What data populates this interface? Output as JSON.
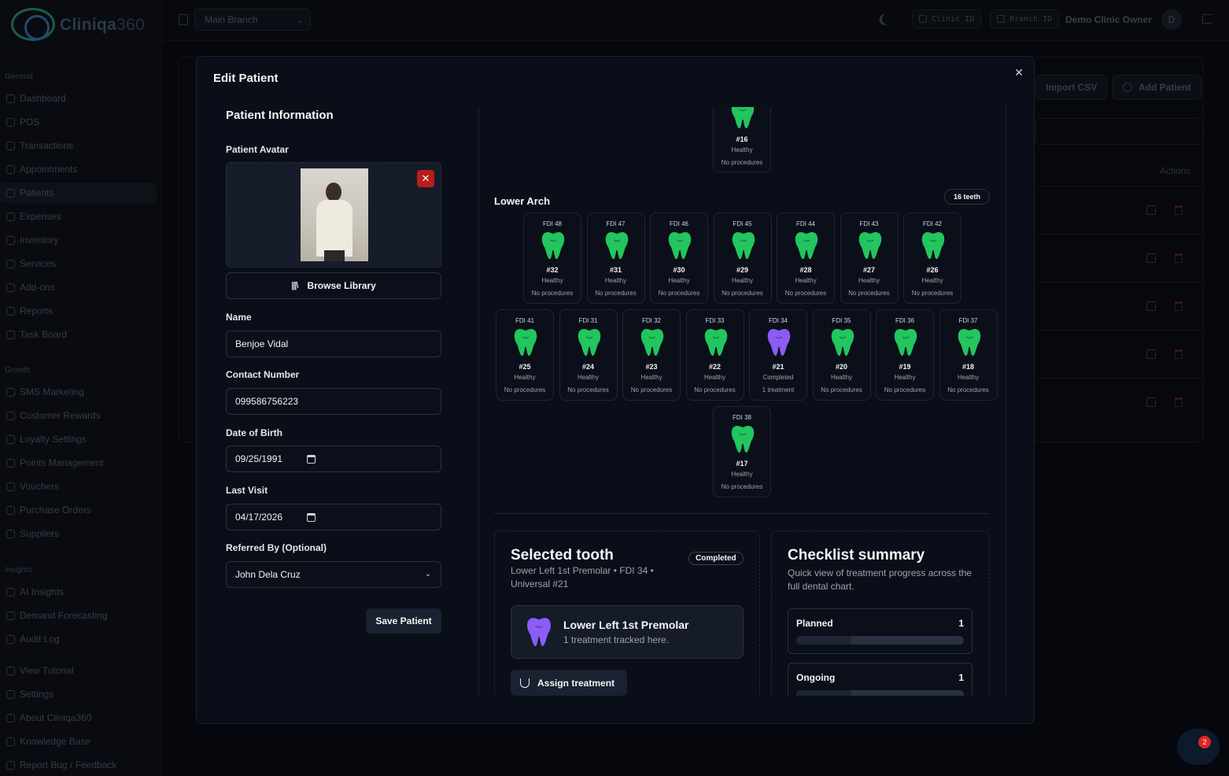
{
  "app": {
    "name": "Cliniqa",
    "name_suffix": "360"
  },
  "sidebar": {
    "sections": [
      {
        "title": "General",
        "items": [
          "Dashboard",
          "POS",
          "Transactions",
          "Appointments",
          "Patients",
          "Expenses",
          "Inventory",
          "Services",
          "Add-ons",
          "Reports",
          "Task Board"
        ]
      },
      {
        "title": "Growth",
        "items": [
          "SMS Marketing",
          "Customer Rewards",
          "Loyalty Settings",
          "Points Management",
          "Vouchers",
          "Purchase Orders",
          "Suppliers"
        ]
      },
      {
        "title": "Insights",
        "items": [
          "AI Insights",
          "Demand Forecasting",
          "Audit Log"
        ]
      }
    ],
    "footer_items": [
      "View Tutorial",
      "Settings",
      "About Cliniqa360",
      "Knowledge Base",
      "Report Bug / Feedback"
    ],
    "active_item": "Patients"
  },
  "topbar": {
    "branch": "Main Branch",
    "clinic_id_label": "Clinic ID",
    "branch_id_label": "Branch ID",
    "owner": "Demo Clinic Owner",
    "avatar_initial": "D"
  },
  "background": {
    "import_label": "Import CSV",
    "add_label": "Add Patient",
    "actions_header": "Actions"
  },
  "notifications": {
    "count": "2"
  },
  "modal": {
    "title": "Edit Patient",
    "form": {
      "section_title": "Patient Information",
      "avatar_label": "Patient Avatar",
      "browse_label": "Browse Library",
      "name_label": "Name",
      "name_value": "Benjoe Vidal",
      "contact_label": "Contact Number",
      "contact_value": "099586756223",
      "dob_label": "Date of Birth",
      "dob_value": "09/25/1991",
      "last_visit_label": "Last Visit",
      "last_visit_value": "04/17/2026",
      "referred_label": "Referred By (Optional)",
      "referred_value": "John Dela Cruz",
      "save_label": "Save Patient"
    },
    "chart": {
      "upper_partial": {
        "fdi": "",
        "number": "#16",
        "status": "Healthy",
        "procedures": "No procedures"
      },
      "lower_title": "Lower Arch",
      "lower_count": "16 teeth",
      "lower_row1": [
        {
          "fdi": "FDI 48",
          "number": "#32",
          "status": "Healthy",
          "procedures": "No procedures",
          "color": "#22c55e"
        },
        {
          "fdi": "FDI 47",
          "number": "#31",
          "status": "Healthy",
          "procedures": "No procedures",
          "color": "#22c55e"
        },
        {
          "fdi": "FDI 46",
          "number": "#30",
          "status": "Healthy",
          "procedures": "No procedures",
          "color": "#22c55e"
        },
        {
          "fdi": "FDI 45",
          "number": "#29",
          "status": "Healthy",
          "procedures": "No procedures",
          "color": "#22c55e"
        },
        {
          "fdi": "FDI 44",
          "number": "#28",
          "status": "Healthy",
          "procedures": "No procedures",
          "color": "#22c55e"
        },
        {
          "fdi": "FDI 43",
          "number": "#27",
          "status": "Healthy",
          "procedures": "No procedures",
          "color": "#22c55e"
        },
        {
          "fdi": "FDI 42",
          "number": "#26",
          "status": "Healthy",
          "procedures": "No procedures",
          "color": "#22c55e"
        }
      ],
      "lower_row2": [
        {
          "fdi": "FDI 41",
          "number": "#25",
          "status": "Healthy",
          "procedures": "No procedures",
          "color": "#22c55e"
        },
        {
          "fdi": "FDI 31",
          "number": "#24",
          "status": "Healthy",
          "procedures": "No procedures",
          "color": "#22c55e"
        },
        {
          "fdi": "FDI 32",
          "number": "#23",
          "status": "Healthy",
          "procedures": "No procedures",
          "color": "#22c55e"
        },
        {
          "fdi": "FDI 33",
          "number": "#22",
          "status": "Healthy",
          "procedures": "No procedures",
          "color": "#22c55e"
        },
        {
          "fdi": "FDI 34",
          "number": "#21",
          "status": "Completed",
          "procedures": "1 treatment",
          "color": "#8b5cf6"
        },
        {
          "fdi": "FDI 35",
          "number": "#20",
          "status": "Healthy",
          "procedures": "No procedures",
          "color": "#22c55e"
        },
        {
          "fdi": "FDI 36",
          "number": "#19",
          "status": "Healthy",
          "procedures": "No procedures",
          "color": "#22c55e"
        },
        {
          "fdi": "FDI 37",
          "number": "#18",
          "status": "Healthy",
          "procedures": "No procedures",
          "color": "#22c55e"
        }
      ],
      "lower_row3": [
        {
          "fdi": "FDI 38",
          "number": "#17",
          "status": "Healthy",
          "procedures": "No procedures",
          "color": "#22c55e"
        }
      ]
    },
    "selected": {
      "title": "Selected tooth",
      "subtitle": "Lower Left 1st Premolar • FDI 34 • Universal #21",
      "badge": "Completed",
      "tooth_name": "Lower Left 1st Premolar",
      "tooth_note": "1 treatment tracked here.",
      "assign_label": "Assign treatment",
      "tooth_color": "#8b5cf6"
    },
    "checklist": {
      "title": "Checklist summary",
      "subtitle": "Quick view of treatment progress across the full dental chart.",
      "items": [
        {
          "label": "Planned",
          "count": "1",
          "progress": 0.33
        },
        {
          "label": "Ongoing",
          "count": "1",
          "progress": 0.33
        }
      ]
    }
  }
}
